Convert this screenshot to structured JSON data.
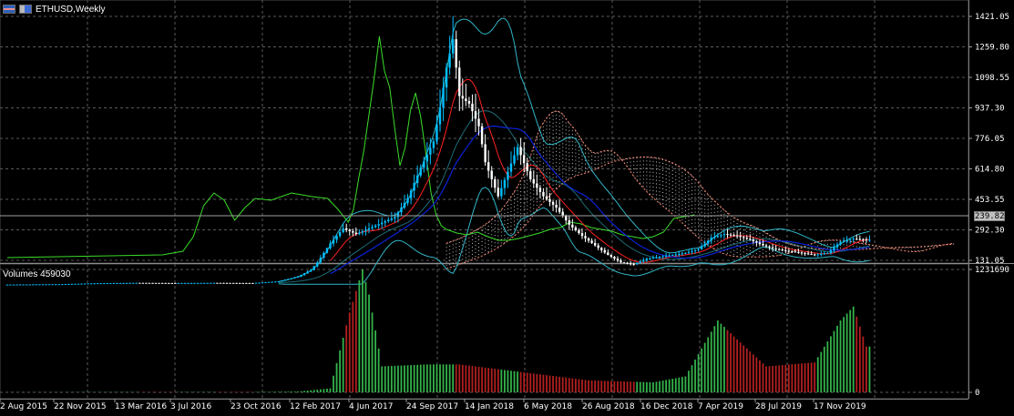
{
  "window": {
    "symbol_title": "ETHUSD,Weekly",
    "volumes_label": "Volumes 459030"
  },
  "price_axis": {
    "labels": [
      "1421.05",
      "1259.80",
      "1098.55",
      "937.30",
      "776.05",
      "614.80",
      "453.55",
      "292.30",
      "131.05"
    ],
    "current_price": "239.82"
  },
  "volume_axis": {
    "labels": [
      "1231690",
      "0"
    ]
  },
  "time_axis": {
    "labels": [
      "2 Aug 2015",
      "22 Nov 2015",
      "13 Mar 2016",
      "3 Jul 2016",
      "23 Oct 2016",
      "12 Feb 2017",
      "4 Jun 2017",
      "24 Sep 2017",
      "14 Jan 2018",
      "6 May 2018",
      "26 Aug 2018",
      "16 Dec 2018",
      "7 Apr 2019",
      "28 Jul 2019",
      "17 Nov 2019"
    ]
  },
  "colors": {
    "background": "#000000",
    "grid": "#5a5a5a",
    "candle_up": "#00bfff",
    "candle_down": "#ffffff",
    "ma_red": "#ff2020",
    "ma_blue": "#0b22d8",
    "bollinger": "#2fb6c8",
    "oscillator_green": "#3bdc2a",
    "cloud_dots": "#ffffff",
    "cloud_edge": "#ff8a75",
    "volume_up": "#33b24a",
    "volume_down": "#b21f1f",
    "current_price_box": "#c0c0c0"
  },
  "icons": {
    "symbol_flag": "flag-icon"
  },
  "chart_data": {
    "type": "candlestick",
    "symbol": "ETHUSD",
    "timeframe": "Weekly",
    "price_scale": {
      "min": 131.05,
      "max": 1421.05,
      "ticks": [
        1421.05,
        1259.8,
        1098.55,
        937.3,
        776.05,
        614.8,
        453.55,
        292.3,
        131.05
      ],
      "last": 239.82
    },
    "volume_scale": {
      "min": 0,
      "max": 1231690,
      "last": 459030
    },
    "x_labels": [
      "2 Aug 2015",
      "22 Nov 2015",
      "13 Mar 2016",
      "3 Jul 2016",
      "23 Oct 2016",
      "12 Feb 2017",
      "4 Jun 2017",
      "24 Sep 2017",
      "14 Jan 2018",
      "6 May 2018",
      "26 Aug 2018",
      "16 Dec 2018",
      "7 Apr 2019",
      "28 Jul 2019",
      "17 Nov 2019"
    ],
    "approx_close_series": [
      [
        0,
        3
      ],
      [
        8,
        4
      ],
      [
        16,
        5
      ],
      [
        28,
        10
      ],
      [
        40,
        12
      ],
      [
        52,
        11
      ],
      [
        64,
        12
      ],
      [
        76,
        11
      ],
      [
        84,
        20
      ],
      [
        90,
        45
      ],
      [
        94,
        80
      ],
      [
        96,
        120
      ],
      [
        100,
        220
      ],
      [
        104,
        300
      ],
      [
        108,
        270
      ],
      [
        112,
        300
      ],
      [
        116,
        330
      ],
      [
        120,
        360
      ],
      [
        124,
        460
      ],
      [
        128,
        620
      ],
      [
        132,
        760
      ],
      [
        134,
        940
      ],
      [
        136,
        1150
      ],
      [
        138,
        1300
      ],
      [
        140,
        1000
      ],
      [
        143,
        960
      ],
      [
        146,
        840
      ],
      [
        148,
        650
      ],
      [
        150,
        560
      ],
      [
        152,
        470
      ],
      [
        155,
        600
      ],
      [
        158,
        730
      ],
      [
        162,
        560
      ],
      [
        166,
        470
      ],
      [
        170,
        410
      ],
      [
        174,
        320
      ],
      [
        178,
        260
      ],
      [
        182,
        210
      ],
      [
        186,
        160
      ],
      [
        190,
        120
      ],
      [
        194,
        110
      ],
      [
        198,
        140
      ],
      [
        202,
        150
      ],
      [
        206,
        160
      ],
      [
        210,
        170
      ],
      [
        214,
        190
      ],
      [
        218,
        250
      ],
      [
        222,
        270
      ],
      [
        226,
        260
      ],
      [
        230,
        240
      ],
      [
        234,
        210
      ],
      [
        238,
        190
      ],
      [
        242,
        180
      ],
      [
        246,
        170
      ],
      [
        250,
        160
      ],
      [
        254,
        170
      ],
      [
        258,
        230
      ],
      [
        262,
        245
      ],
      [
        266,
        240
      ]
    ],
    "approx_volume_series": [
      [
        0,
        1000
      ],
      [
        20,
        2000
      ],
      [
        40,
        3000
      ],
      [
        60,
        3000
      ],
      [
        80,
        4000
      ],
      [
        90,
        8000
      ],
      [
        100,
        40000
      ],
      [
        106,
        800000
      ],
      [
        110,
        1231690
      ],
      [
        112,
        980000
      ],
      [
        116,
        260000
      ],
      [
        130,
        280000
      ],
      [
        140,
        280000
      ],
      [
        160,
        200000
      ],
      [
        180,
        120000
      ],
      [
        200,
        100000
      ],
      [
        210,
        160000
      ],
      [
        220,
        720000
      ],
      [
        225,
        560000
      ],
      [
        235,
        260000
      ],
      [
        250,
        300000
      ],
      [
        258,
        720000
      ],
      [
        262,
        860000
      ],
      [
        266,
        459030
      ]
    ],
    "grid": true
  }
}
